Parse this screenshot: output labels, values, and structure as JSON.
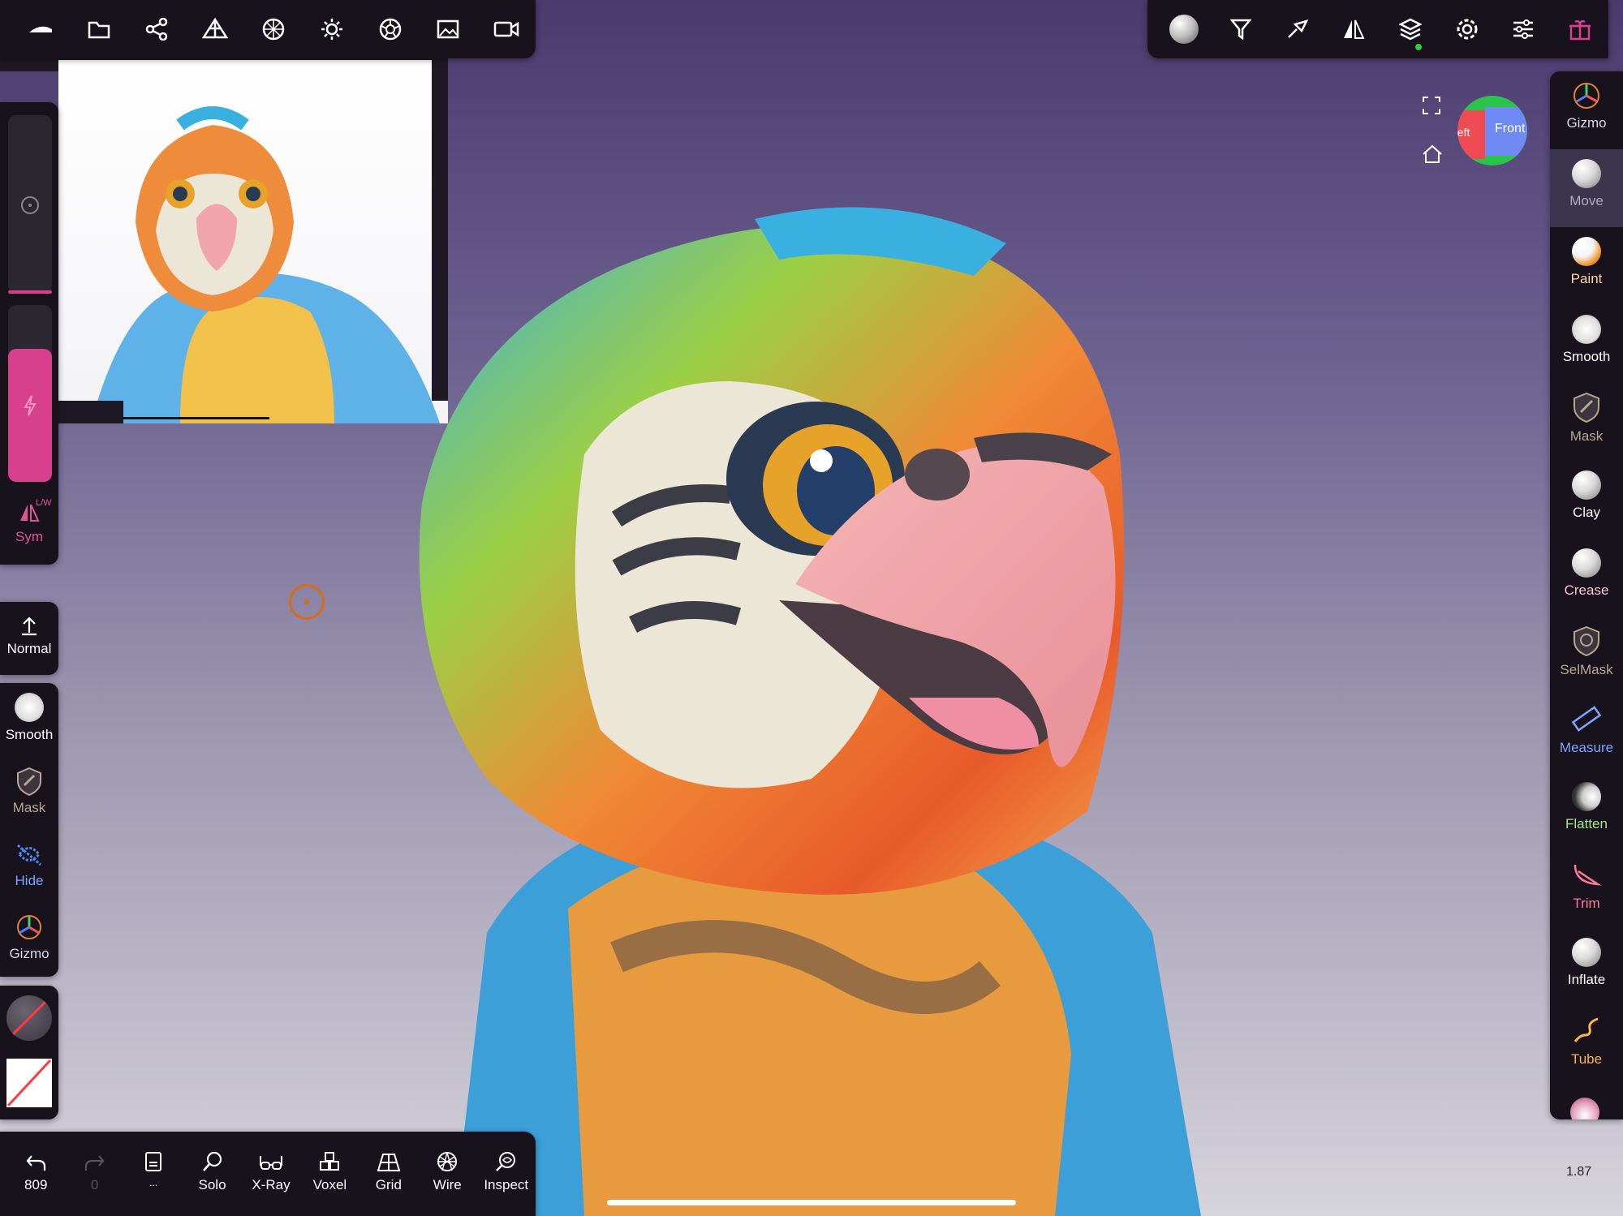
{
  "colors": {
    "accent_pink": "#d83f8c",
    "sym_pink": "#e2549a",
    "measure_blue": "#7aa6ff",
    "selmask_orange": "#e0b070",
    "flatten_green": "#a7e58b",
    "trim_pink": "#ff7a9a",
    "tube_orange": "#ffb24a",
    "hide_blue": "#4a8cff",
    "cursor_orange": "#d96b17"
  },
  "top_toolbar": {
    "icons": [
      "nomad-logo-icon",
      "folder-icon",
      "scene-graph-icon",
      "mesh-icon",
      "topology-icon",
      "light-icon",
      "material-icon",
      "image-icon",
      "camera-icon"
    ]
  },
  "right_toolbar": {
    "icons": [
      "material-sphere-icon",
      "filter-icon",
      "brush-icon",
      "symmetry-icon",
      "layers-icon",
      "gear-icon",
      "sliders-icon",
      "gift-icon"
    ]
  },
  "right_tools": [
    {
      "label": "Gizmo",
      "icon": "gizmo-icon"
    },
    {
      "label": "Move",
      "icon": "move-sphere-icon",
      "active": true
    },
    {
      "label": "Paint",
      "icon": "paint-sphere-icon"
    },
    {
      "label": "Smooth",
      "icon": "smooth-sphere-icon"
    },
    {
      "label": "Mask",
      "icon": "mask-shield-icon"
    },
    {
      "label": "Clay",
      "icon": "clay-sphere-icon"
    },
    {
      "label": "Crease",
      "icon": "crease-sphere-icon"
    },
    {
      "label": "SelMask",
      "icon": "selmask-shield-icon"
    },
    {
      "label": "Measure",
      "icon": "ruler-icon"
    },
    {
      "label": "Flatten",
      "icon": "flatten-sphere-icon"
    },
    {
      "label": "Trim",
      "icon": "trim-icon"
    },
    {
      "label": "Inflate",
      "icon": "inflate-sphere-icon"
    },
    {
      "label": "Tube",
      "icon": "tube-icon"
    }
  ],
  "left_panel": {
    "sym_label": "Sym",
    "sym_badge": "L/W",
    "normal_label": "Normal",
    "tools": [
      {
        "label": "Smooth",
        "icon": "smooth-sphere-icon"
      },
      {
        "label": "Mask",
        "icon": "mask-shield-icon"
      },
      {
        "label": "Hide",
        "icon": "hide-icon"
      },
      {
        "label": "Gizmo",
        "icon": "gizmo-icon"
      }
    ]
  },
  "bottom_bar": [
    {
      "label": "809",
      "icon": "undo-icon"
    },
    {
      "label": "0",
      "icon": "redo-icon",
      "disabled": true
    },
    {
      "label": "...",
      "icon": "document-icon"
    },
    {
      "label": "Solo",
      "icon": "solo-search-icon"
    },
    {
      "label": "X-Ray",
      "icon": "xray-glasses-icon"
    },
    {
      "label": "Voxel",
      "icon": "voxel-icon"
    },
    {
      "label": "Grid",
      "icon": "grid-icon"
    },
    {
      "label": "Wire",
      "icon": "wire-icon"
    },
    {
      "label": "Inspect",
      "icon": "inspect-icon"
    }
  ],
  "view_cube": {
    "left": "Left",
    "front": "Front"
  },
  "version": "1.87"
}
